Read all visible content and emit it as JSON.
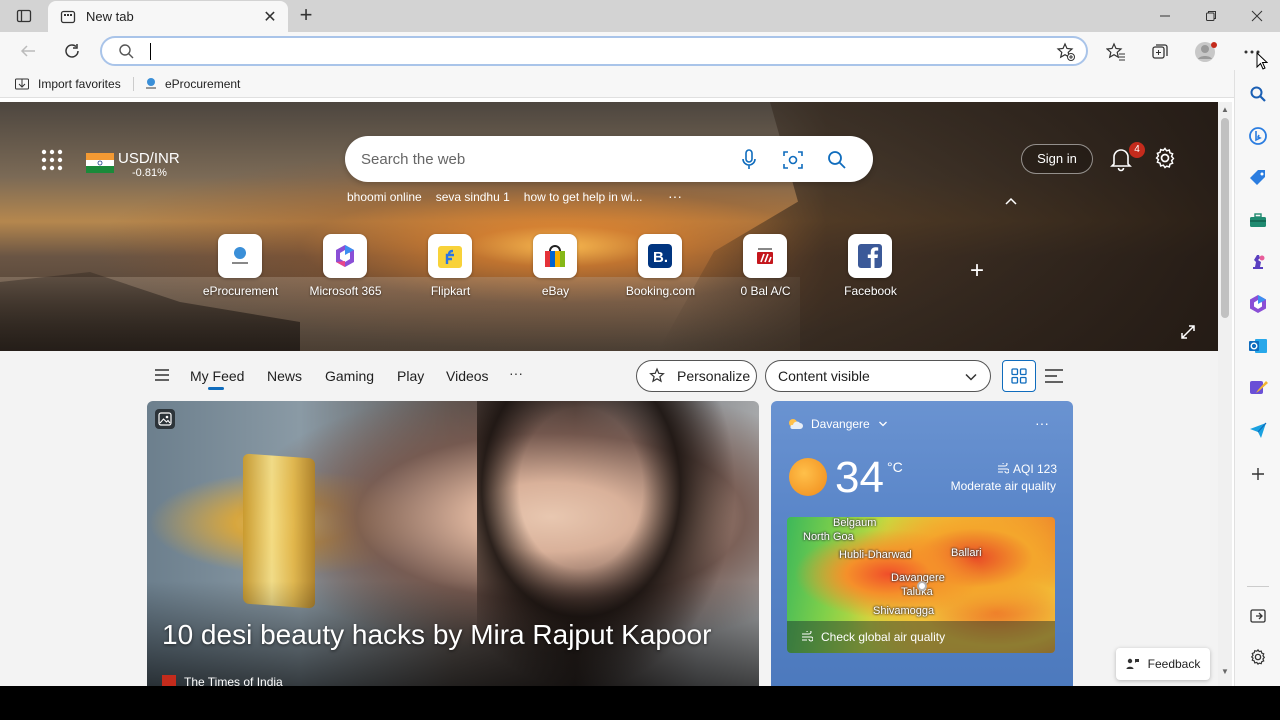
{
  "tab": {
    "label": "New tab"
  },
  "favorites": [
    {
      "label": "Import favorites",
      "icon": "import-favorites-icon"
    },
    {
      "label": "eProcurement",
      "icon": "eprocurement-favicon"
    }
  ],
  "hero": {
    "fx": {
      "pair": "USD/INR",
      "change": "-0.81%"
    },
    "search_placeholder": "Search the web",
    "trending": [
      "bhoomi online",
      "seva sindhu 1",
      "how to get help in wi..."
    ],
    "signin_label": "Sign in",
    "notification_count": "4",
    "tiles": [
      {
        "label": "eProcurement",
        "icon": "eprocurement-icon"
      },
      {
        "label": "Microsoft 365",
        "icon": "microsoft365-icon"
      },
      {
        "label": "Flipkart",
        "icon": "flipkart-icon"
      },
      {
        "label": "eBay",
        "icon": "ebay-icon"
      },
      {
        "label": "Booking.com",
        "icon": "booking-icon"
      },
      {
        "label": "0 Bal A/C",
        "icon": "bank-icon"
      },
      {
        "label": "Facebook",
        "icon": "facebook-icon"
      }
    ]
  },
  "feednav": {
    "items": [
      "My Feed",
      "News",
      "Gaming",
      "Play",
      "Videos"
    ],
    "active": "My Feed",
    "personalize_label": "Personalize",
    "content_visible_label": "Content visible"
  },
  "main_card": {
    "headline": "10 desi beauty hacks by Mira Rajput Kapoor",
    "source": "The Times of India"
  },
  "weather": {
    "location": "Davangere",
    "temperature": "34",
    "unit": "°C",
    "aqi": "AQI 123",
    "aqi_desc": "Moderate air quality",
    "cities": [
      "Belgaum",
      "North Goa",
      "Hubli-Dharwad",
      "Ballari",
      "Davangere",
      "Taluka",
      "Shivamogga"
    ],
    "cta": "Check global air quality"
  },
  "feedback_label": "Feedback",
  "colors": {
    "accent": "#0f6cbd",
    "badge": "#c42b1c",
    "omnibox_border": "#a9c4e9"
  }
}
